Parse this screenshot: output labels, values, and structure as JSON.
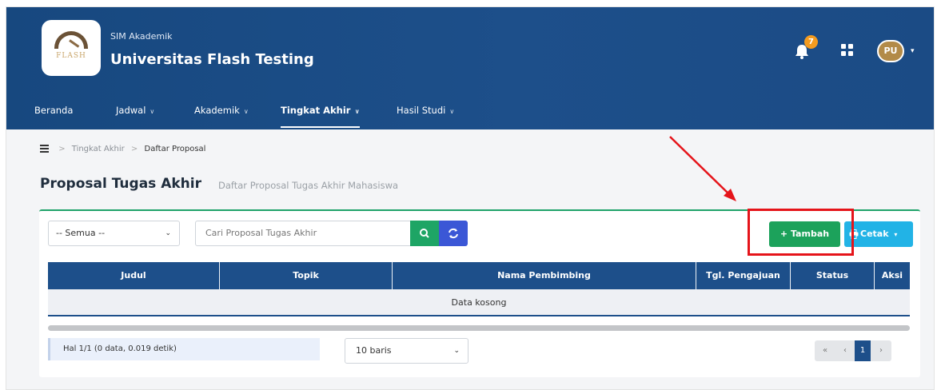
{
  "header": {
    "app_subtitle": "SIM Akademik",
    "app_title": "Universitas Flash Testing",
    "logo_text": "FLASH",
    "notification_count": "7",
    "avatar_initials": "PU",
    "avatar_caret": "▾",
    "colors": {
      "header_bg": "#1d4f8a",
      "badge": "#f49b1f",
      "avatar": "#b28a48"
    }
  },
  "nav": {
    "items": [
      {
        "label": "Beranda",
        "has_dropdown": false,
        "active": false
      },
      {
        "label": "Jadwal",
        "has_dropdown": true,
        "active": false
      },
      {
        "label": "Akademik",
        "has_dropdown": true,
        "active": false
      },
      {
        "label": "Tingkat Akhir",
        "has_dropdown": true,
        "active": true
      },
      {
        "label": "Hasil Studi",
        "has_dropdown": true,
        "active": false
      }
    ],
    "dropdown_glyph": "∨"
  },
  "breadcrumb": {
    "separator": ">",
    "items": [
      "Tingkat Akhir",
      "Daftar Proposal"
    ]
  },
  "page": {
    "title": "Proposal Tugas Akhir",
    "subtitle": "Daftar Proposal Tugas Akhir Mahasiswa"
  },
  "toolbar": {
    "filter_selected": "-- Semua --",
    "filter_chevron": "⌄",
    "search_placeholder": "Cari Proposal Tugas Akhir",
    "add_label": "Tambah",
    "add_glyph": "+",
    "print_label": "Cetak",
    "print_caret": "▾",
    "colors": {
      "search_button": "#1ea565",
      "refresh_button": "#3b57d6",
      "add_button": "#1ca25b",
      "print_button": "#22b3e6"
    }
  },
  "table": {
    "columns": [
      "Judul",
      "Topik",
      "Nama Pembimbing",
      "Tgl. Pengajuan",
      "Status",
      "Aksi"
    ],
    "empty_message": "Data kosong"
  },
  "footer": {
    "page_info": "Hal 1/1 (0 data, 0.019 detik)",
    "rows_selected": "10 baris",
    "rows_chevron": "⌄",
    "pager": {
      "first": "«",
      "prev": "‹",
      "current": "1",
      "next": "›"
    }
  },
  "annotation": {
    "highlight_color": "#e5141a"
  }
}
